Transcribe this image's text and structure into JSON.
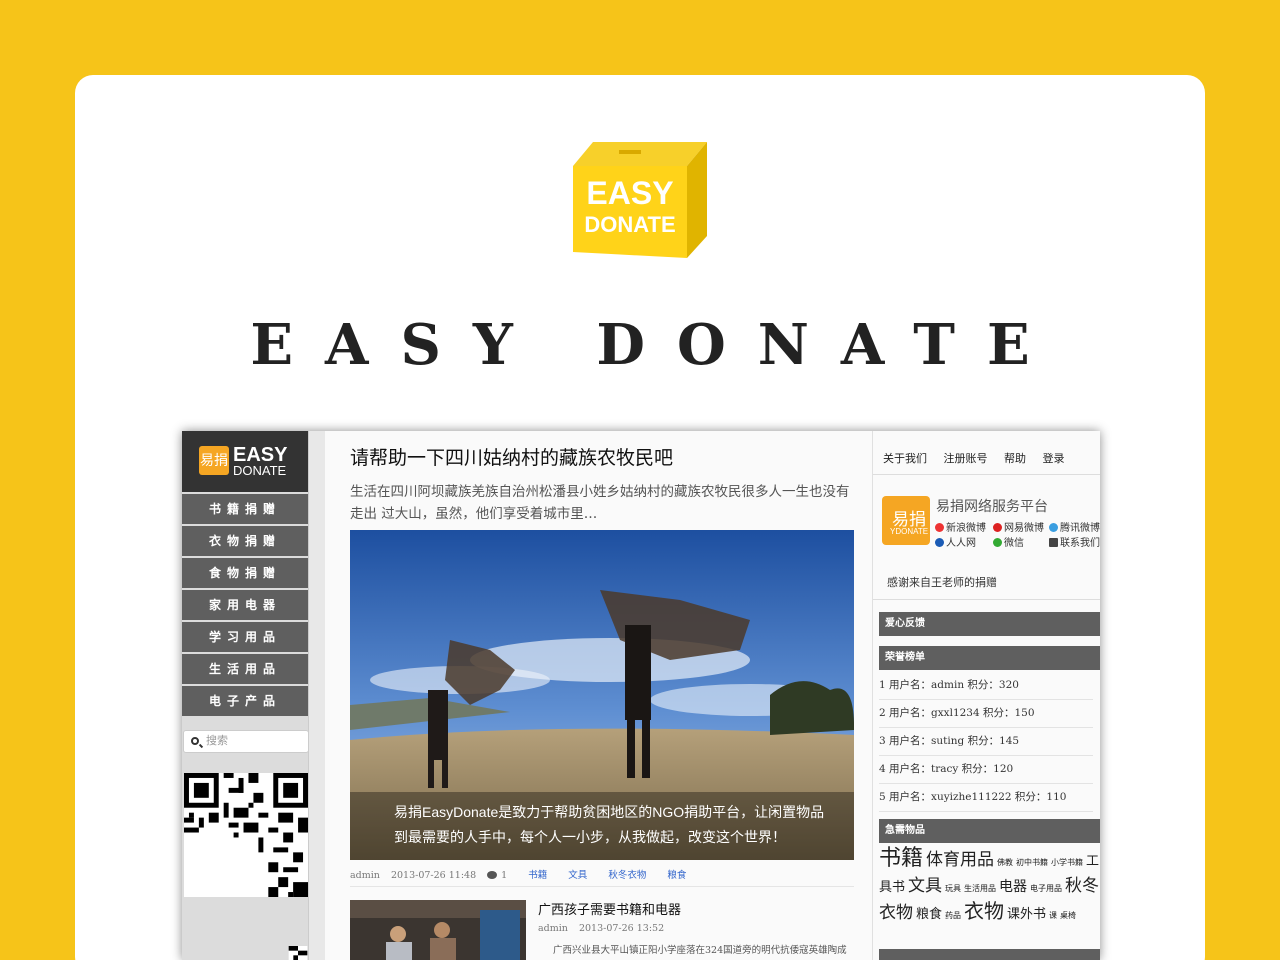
{
  "brand": {
    "box_line1": "EASY",
    "box_line2": "DONATE",
    "title": "EASY DONATE"
  },
  "sidebar": {
    "logo_mark": "易捐",
    "logo_line1": "EASY",
    "logo_line2": "DONATE",
    "items": [
      {
        "label": "书籍捐赠"
      },
      {
        "label": "衣物捐赠"
      },
      {
        "label": "食物捐赠"
      },
      {
        "label": "家用电器"
      },
      {
        "label": "学习用品"
      },
      {
        "label": "生活用品"
      },
      {
        "label": "电子产品"
      }
    ],
    "search_placeholder": "搜索"
  },
  "post": {
    "title": "请帮助一下四川姑纳村的藏族农牧民吧",
    "excerpt": "生活在四川阿坝藏族羌族自治州松潘县小姓乡姑纳村的藏族农牧民很多人一生也没有走出 过大山，虽然，他们享受着城市里…",
    "caption_line1": "易捐EasyDonate是致力于帮助贫困地区的NGO捐助平台，让闲置物品",
    "caption_line2": "到最需要的人手中，每个人一小步，从我做起，改变这个世界！",
    "author": "admin",
    "date": "2013-07-26 11:48",
    "comments": "1",
    "tags": [
      "书籍",
      "文具",
      "秋冬衣物",
      "粮食"
    ]
  },
  "post2": {
    "title": "广西孩子需要书籍和电器",
    "author": "admin",
    "date": "2013-07-26 13:52",
    "body": "广西兴业县大平山镇正阳小学座落在324国道旁的明代抗倭寇英雄陶成"
  },
  "right": {
    "topnav": [
      "关于我们",
      "注册账号",
      "帮助",
      "登录"
    ],
    "platform_mark": "易捐",
    "platform_mark_sub": "YDONATE",
    "platform_name": "易捐网络服务平台",
    "social": [
      "新浪微博",
      "网易微博",
      "腾讯微博",
      "人人网",
      "微信",
      "联系我们"
    ],
    "thanks": "感谢来自王老师的捐赠",
    "feedback_title": "爱心反馈",
    "honor_title": "荣誉榜单",
    "ranks": [
      "1 用户名：admin 积分：320",
      "2 用户名：gxxl1234 积分：150",
      "3 用户名：suting 积分：145",
      "4 用户名：tracy 积分：120",
      "5 用户名：xuyizhe111222 积分：110"
    ],
    "urgent_title": "急需物品",
    "cloud": [
      {
        "text": "书籍",
        "size": 22
      },
      {
        "text": "体育用品",
        "size": 17
      },
      {
        "text": "佛教",
        "size": 8
      },
      {
        "text": "初中书籍",
        "size": 8
      },
      {
        "text": "小学书籍",
        "size": 8
      },
      {
        "text": "工具书",
        "size": 13
      },
      {
        "text": "文具",
        "size": 17
      },
      {
        "text": "玩具",
        "size": 8
      },
      {
        "text": "生活用品",
        "size": 8
      },
      {
        "text": "电器",
        "size": 14
      },
      {
        "text": "电子用品",
        "size": 8
      },
      {
        "text": "秋冬衣物",
        "size": 17
      },
      {
        "text": "粮食",
        "size": 13
      },
      {
        "text": "药品",
        "size": 8
      },
      {
        "text": "衣物",
        "size": 20
      },
      {
        "text": "课外书",
        "size": 13
      },
      {
        "text": "课",
        "size": 8
      },
      {
        "text": "桌椅",
        "size": 8
      }
    ]
  }
}
